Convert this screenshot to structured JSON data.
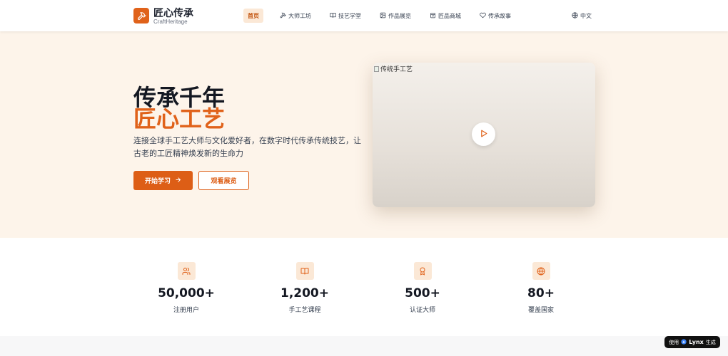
{
  "brand": {
    "name": "匠心传承",
    "subtitle": "CraftHeritage"
  },
  "nav": {
    "items": [
      {
        "label": "首页",
        "icon": "none",
        "active": true
      },
      {
        "label": "大师工坊",
        "icon": "hammer-icon"
      },
      {
        "label": "技艺学堂",
        "icon": "book-icon"
      },
      {
        "label": "作品展览",
        "icon": "image-icon"
      },
      {
        "label": "匠品商城",
        "icon": "bag-icon"
      },
      {
        "label": "传承故事",
        "icon": "heart-icon"
      }
    ],
    "language": "中文"
  },
  "hero": {
    "title_line1": "传承千年",
    "title_line2": "匠心工艺",
    "description": "连接全球手工艺大师与文化爱好者，在数字时代传承传统技艺，让古老的工匠精神焕发新的生命力",
    "primary_button": "开始学习",
    "secondary_button": "观看展览",
    "video_alt": "传统手工艺"
  },
  "stats": [
    {
      "value": "50,000+",
      "label": "注册用户",
      "icon": "users-icon"
    },
    {
      "value": "1,200+",
      "label": "手工艺课程",
      "icon": "book-open-icon"
    },
    {
      "value": "500+",
      "label": "认证大师",
      "icon": "award-icon"
    },
    {
      "value": "80+",
      "label": "覆盖国家",
      "icon": "globe-icon"
    }
  ],
  "badge": {
    "prefix": "使用",
    "name": "Lynx",
    "suffix": "生成"
  },
  "colors": {
    "accent": "#e0621a",
    "hero_bg": "#fdf4ea",
    "icon_bg": "#fbe8d6"
  }
}
